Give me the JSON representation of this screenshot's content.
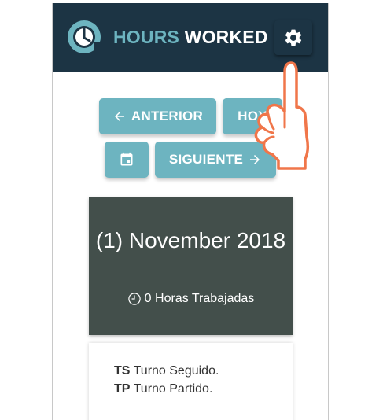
{
  "app": {
    "title_part1": "HOURS",
    "title_part2": "WORKED",
    "logo_icon": "clock-logo-icon",
    "settings_icon": "gear-icon"
  },
  "nav": {
    "prev_label": "ANTERIOR",
    "today_label": "HOY",
    "calendar_icon": "calendar-icon",
    "next_label": "SIGUIENTE"
  },
  "date_card": {
    "title": "(1) November 2018",
    "hours_text": "0 Horas Trabajadas"
  },
  "legend": [
    {
      "code": "TS",
      "text": "Turno Seguido."
    },
    {
      "code": "TP",
      "text": "Turno Partido."
    }
  ],
  "colors": {
    "appbar": "#1c3444",
    "accent": "#6db4c0",
    "card": "#434f4b",
    "pointer": "#f0764a"
  }
}
